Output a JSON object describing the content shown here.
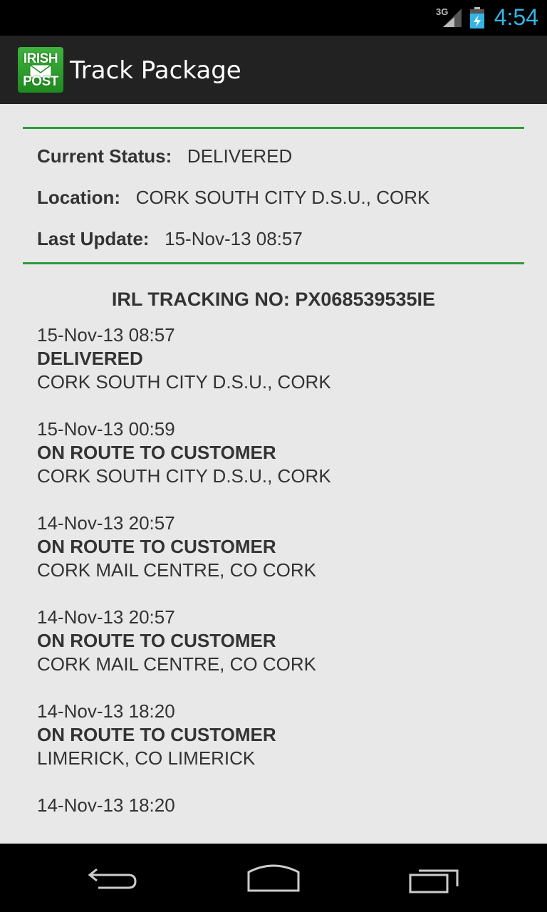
{
  "status_bar": {
    "network": "3G",
    "clock": "4:54",
    "clock_color": "#33b5e5"
  },
  "action_bar": {
    "logo_top": "IRISH",
    "logo_bottom": "POST",
    "title": "Track Package"
  },
  "summary": {
    "status_label": "Current Status:",
    "status_value": "DELIVERED",
    "location_label": "Location:",
    "location_value": "CORK SOUTH CITY D.S.U., CORK",
    "update_label": "Last Update:",
    "update_value": "15-Nov-13 08:57"
  },
  "tracking": {
    "heading": "IRL TRACKING NO: PX068539535IE"
  },
  "events": [
    {
      "time": "15-Nov-13 08:57",
      "status": "DELIVERED",
      "location": "CORK SOUTH CITY D.S.U., CORK"
    },
    {
      "time": "15-Nov-13 00:59",
      "status": "ON ROUTE TO CUSTOMER",
      "location": "CORK SOUTH CITY D.S.U., CORK"
    },
    {
      "time": "14-Nov-13 20:57",
      "status": "ON ROUTE TO CUSTOMER",
      "location": "CORK MAIL CENTRE, CO CORK"
    },
    {
      "time": "14-Nov-13 20:57",
      "status": "ON ROUTE TO CUSTOMER",
      "location": "CORK MAIL CENTRE, CO CORK"
    },
    {
      "time": "14-Nov-13 18:20",
      "status": "ON ROUTE TO CUSTOMER",
      "location": "LIMERICK, CO LIMERICK"
    },
    {
      "time": "14-Nov-13 18:20",
      "status": "",
      "location": ""
    }
  ],
  "colors": {
    "accent_green": "#2e9a3a",
    "background": "#e8e8e8",
    "action_bar": "#222222"
  },
  "icons": {
    "signal": "signal-3g-icon",
    "battery": "battery-charging-icon",
    "back": "back-icon",
    "home": "home-icon",
    "recent": "recent-apps-icon"
  }
}
